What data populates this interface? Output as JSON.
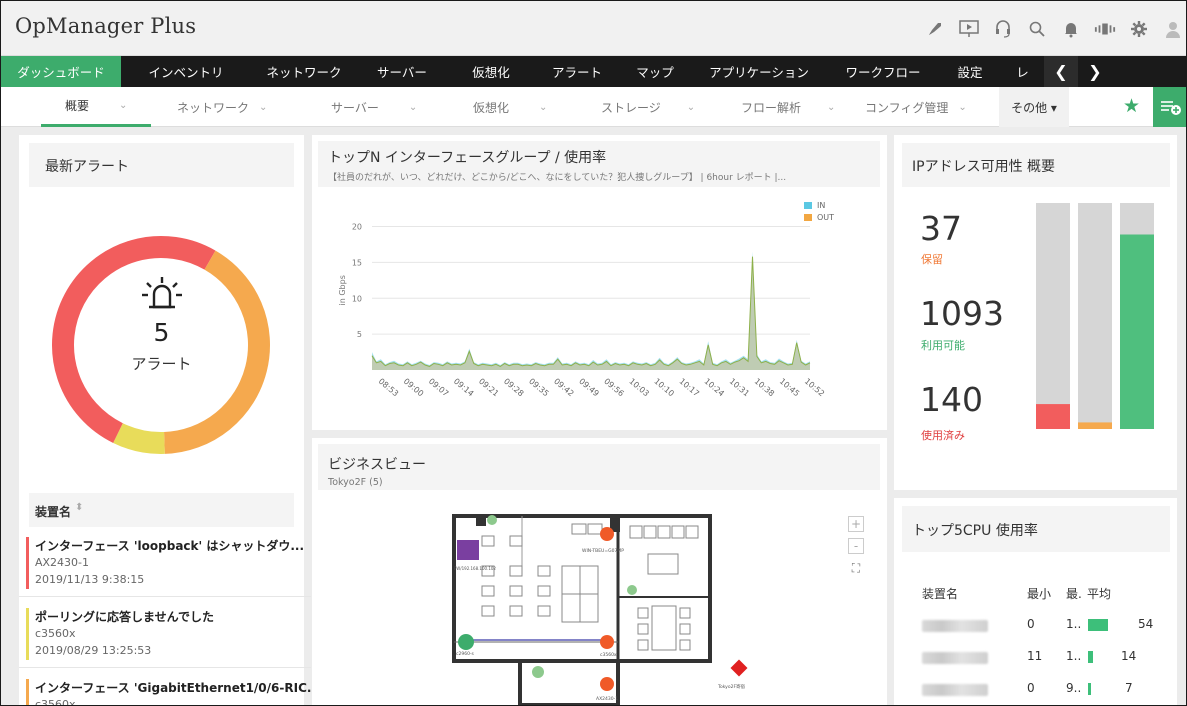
{
  "app": {
    "title": "OpManager Plus"
  },
  "toolbar_icons": [
    "rocket-icon",
    "presentation-icon",
    "headset-icon",
    "search-icon",
    "bell-icon",
    "signal-icon",
    "gear-icon",
    "user-icon"
  ],
  "main_nav": {
    "items": [
      "ダッシュボード",
      "インベントリ",
      "ネットワーク",
      "サーバー",
      "仮想化",
      "アラート",
      "マップ",
      "アプリケーション",
      "ワークフロー",
      "設定",
      "レ"
    ],
    "active": 0
  },
  "sub_nav": {
    "items": [
      "概要",
      "ネットワーク",
      "サーバー",
      "仮想化",
      "ストレージ",
      "フロー解析",
      "コンフィグ管理",
      "その他 ▾"
    ],
    "active": 0
  },
  "alerts_widget": {
    "title": "最新アラート",
    "count": "5",
    "count_label": "アラート",
    "donut_colors": [
      "#f25d5d",
      "#f5a94e",
      "#e8dc5a"
    ],
    "list_header": "装置名",
    "items": [
      {
        "title": "インターフェース 'loopback' はシャットダウ...",
        "device": "AX2430-1",
        "time": "2019/11/13 9:38:15",
        "color": "#f25d5d"
      },
      {
        "title": "ポーリングに応答しませんでした",
        "device": "c3560x",
        "time": "2019/08/29 13:25:53",
        "color": "#e8dc5a"
      },
      {
        "title": "インターフェース 'GigabitEthernet1/0/6-RIC...",
        "device": "c3560x",
        "time": "",
        "color": "#f5a94e"
      }
    ]
  },
  "topn_widget": {
    "title": "トップN インターフェースグループ / 使用率",
    "subtitle": "【社員のだれが、いつ、どれだけ、どこから/どこへ、なにをしていた？犯人捜しグループ】 | 6hour レポート |...",
    "chart_data": {
      "type": "area",
      "ylabel": "in Gbps",
      "ylim": [
        0,
        23
      ],
      "yticks": [
        5,
        10,
        15,
        20
      ],
      "legend": [
        "IN",
        "OUT"
      ],
      "colors": {
        "IN": "#5bc8e3",
        "OUT": "#f2a742"
      },
      "xticks": [
        "08:53",
        "09:00",
        "09:07",
        "09:14",
        "09:21",
        "09:28",
        "09:35",
        "09:42",
        "09:49",
        "09:56",
        "10:03",
        "10:10",
        "10:17",
        "10:24",
        "10:31",
        "10:38",
        "10:45",
        "10:52"
      ],
      "series": [
        {
          "name": "IN",
          "values": [
            2.5,
            1.2,
            1.5,
            0.8,
            1.1,
            1.3,
            0.9,
            0.8,
            1.2,
            0.8,
            1.0,
            1.3,
            0.9,
            0.7,
            1.1,
            1.0,
            0.8,
            1.2,
            0.9,
            1.0,
            0.9,
            1.2,
            3.0,
            1.1,
            0.8,
            1.0,
            0.9,
            0.8,
            1.0,
            0.7,
            1.1,
            0.8,
            1.0,
            1.0,
            0.8,
            0.9,
            0.8,
            1.1,
            0.9,
            0.8,
            1.0,
            1.0,
            1.8,
            0.9,
            1.0,
            0.8,
            1.2,
            0.9,
            1.0,
            0.8,
            1.4,
            0.9,
            1.0,
            1.5,
            0.8,
            1.1,
            0.9,
            1.0,
            0.8,
            1.2,
            1.0,
            0.9,
            1.1,
            0.8,
            1.0,
            1.7,
            1.0,
            0.8,
            1.2,
            1.8,
            1.1,
            0.9,
            1.0,
            1.2,
            1.5,
            0.9,
            4.0,
            1.0,
            0.8,
            1.2,
            1.5,
            1.0,
            1.3,
            1.6,
            2.0,
            1.5,
            16.5,
            2.2,
            1.2,
            1.5,
            1.1,
            1.0,
            1.6,
            1.2,
            0.9,
            1.0,
            4.2,
            1.3,
            0.9,
            1.2
          ]
        },
        {
          "name": "OUT",
          "values": [
            2.0,
            1.0,
            1.2,
            0.6,
            0.9,
            1.0,
            0.7,
            0.6,
            1.0,
            0.6,
            0.8,
            1.1,
            0.7,
            0.5,
            0.9,
            0.8,
            0.6,
            1.0,
            0.7,
            0.8,
            0.7,
            1.0,
            2.6,
            0.9,
            0.6,
            0.8,
            0.7,
            0.6,
            0.8,
            0.5,
            0.9,
            0.6,
            0.8,
            0.8,
            0.6,
            0.7,
            0.6,
            0.9,
            0.7,
            0.6,
            0.8,
            0.8,
            1.5,
            0.7,
            0.8,
            0.6,
            1.0,
            0.7,
            0.8,
            0.6,
            1.1,
            0.7,
            0.8,
            1.2,
            0.6,
            0.9,
            0.7,
            0.8,
            0.6,
            1.0,
            0.8,
            0.7,
            0.9,
            0.6,
            0.8,
            1.4,
            0.8,
            0.6,
            1.0,
            1.5,
            0.9,
            0.7,
            0.8,
            1.0,
            1.2,
            0.7,
            3.5,
            0.8,
            0.6,
            1.0,
            1.2,
            0.8,
            1.1,
            1.3,
            1.7,
            1.2,
            15.8,
            1.9,
            1.0,
            1.2,
            0.9,
            0.8,
            1.3,
            1.0,
            0.7,
            0.8,
            3.8,
            1.1,
            0.7,
            1.0
          ]
        }
      ]
    }
  },
  "business_widget": {
    "title": "ビジネスビュー",
    "subtitle": "Tokyo2F (5)",
    "zoom_in": "+",
    "zoom_out": "-",
    "fit": "⛶",
    "labels": {
      "fw": "FW/192.168.100.102",
      "wln": "WIN-TBEU=G07MP",
      "c2960": "c2960-s",
      "c3560": "c3560x",
      "ax": "AX2430-1",
      "tokyo": "Tokyo2F寄宿"
    }
  },
  "ip_widget": {
    "title": "IPアドレス可用性 概要",
    "stats": [
      {
        "value": "37",
        "label": "保留",
        "color": "#f07a38"
      },
      {
        "value": "1093",
        "label": "利用可能",
        "color": "#3dac6c"
      },
      {
        "value": "140",
        "label": "使用済み",
        "color": "#e04040"
      }
    ],
    "chart_data": {
      "type": "bar",
      "categories": [
        "使用済み",
        "保留",
        "利用可能"
      ],
      "values": [
        140,
        37,
        1093
      ],
      "total": 1270,
      "colors": [
        "#f25d5d",
        "#f5a94e",
        "#4fbf7e"
      ],
      "track_color": "#d6d6d6"
    }
  },
  "cpu_widget": {
    "title": "トップ5CPU 使用率",
    "headers": {
      "name": "装置名",
      "min": "最小",
      "max": "最.",
      "avg": "平均"
    },
    "rows": [
      {
        "min": "0",
        "max": "1..",
        "avg": "54",
        "bar_fraction": 0.54
      },
      {
        "min": "11",
        "max": "1..",
        "avg": "14",
        "bar_fraction": 0.14
      },
      {
        "min": "0",
        "max": "9..",
        "avg": "7",
        "bar_fraction": 0.07
      }
    ]
  }
}
